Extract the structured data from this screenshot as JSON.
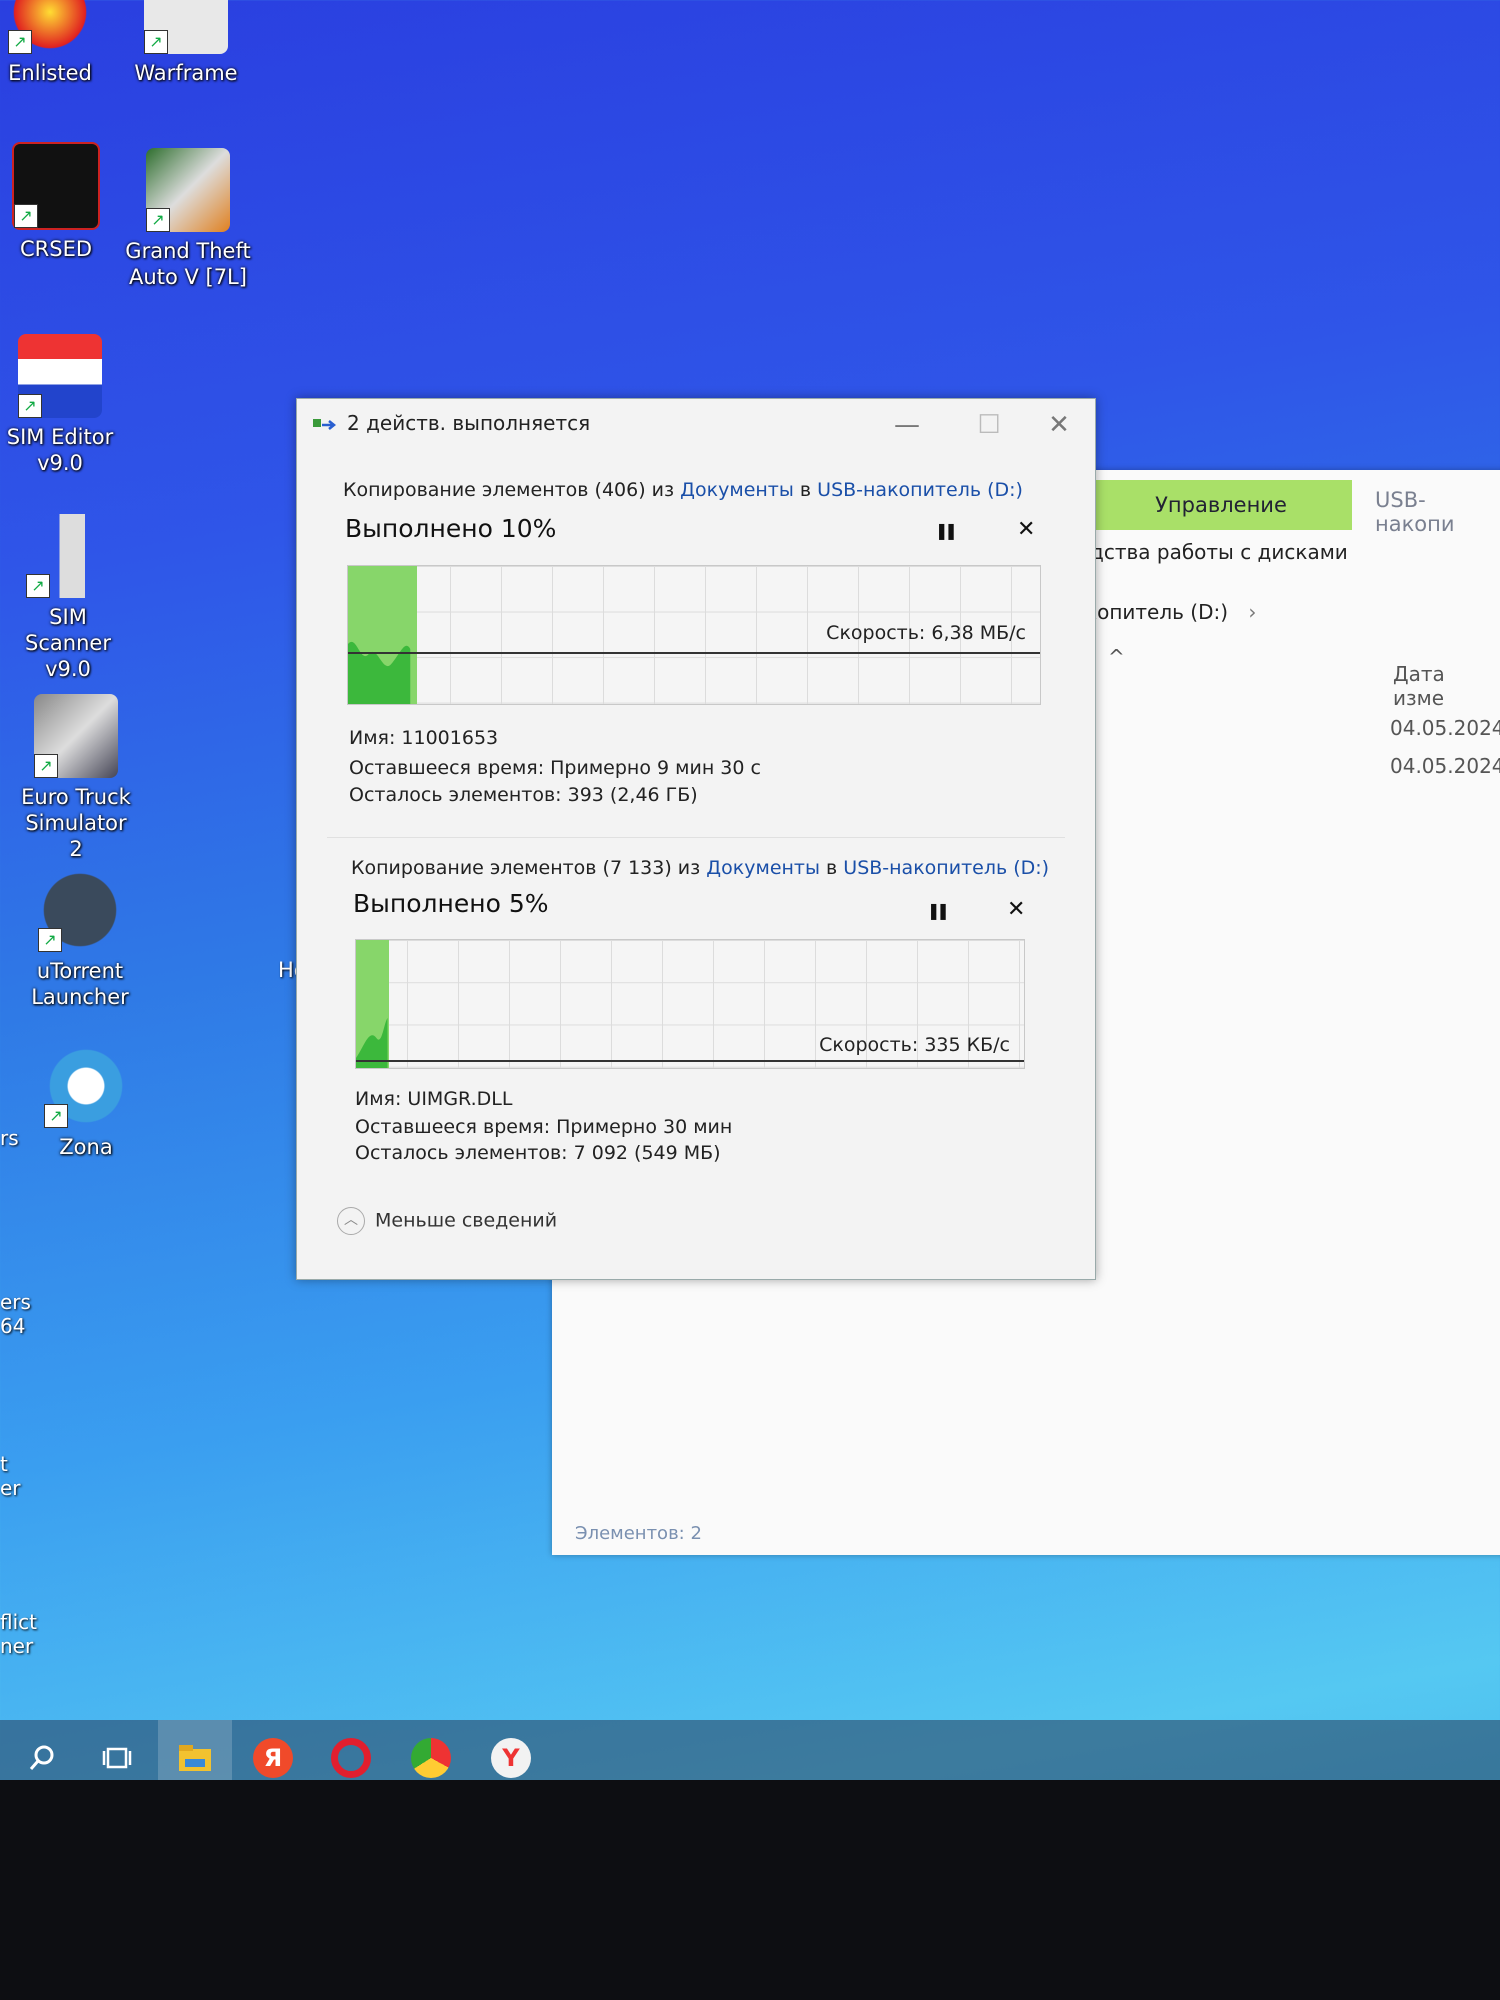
{
  "desktop": {
    "icons": [
      {
        "label": "Enlisted"
      },
      {
        "label": "Warframe"
      },
      {
        "label": "CRSED"
      },
      {
        "label": "Grand Theft Auto V [7L]"
      },
      {
        "label": "SIM Editor v9.0"
      },
      {
        "label": "SIM Scanner v9.0"
      },
      {
        "label": "Euro Truck Simulator 2"
      },
      {
        "label": "uTorrent Launcher"
      },
      {
        "label": "Zona"
      }
    ],
    "partial_labels": [
      "rs",
      "ers",
      "64",
      "t",
      "er",
      "flict",
      "ner",
      "Ho"
    ]
  },
  "explorer": {
    "manage_tab": "Управление",
    "usb_tab": "USB-накопи",
    "tools_text": "дства работы с дисками",
    "address": "копитель (D:)",
    "address_chevron": "›",
    "sort_caret": "^",
    "date_column": "Дата изме",
    "dates": [
      "04.05.2024",
      "04.05.2024"
    ],
    "status": "Элементов: 2"
  },
  "dialog": {
    "title": "2 действ. выполняется",
    "minimize": "—",
    "maximize": "☐",
    "close": "✕",
    "ops": [
      {
        "head_prefix": "Копирование элементов (406) из ",
        "src": "Документы",
        "mid": " в ",
        "dst": "USB-накопитель (D:)",
        "progress_label": "Выполнено 10%",
        "progress": 0.1,
        "pause": "❚❚",
        "cancel": "✕",
        "speed": "Скорость: 6,38 МБ/с",
        "name": "Имя:  11001653",
        "time_left": "Оставшееся время:  Примерно 9 мин 30 с",
        "items_left": "Осталось элементов:  393 (2,46 ГБ)"
      },
      {
        "head_prefix": "Копирование элементов (7 133) из ",
        "src": "Документы",
        "mid": " в ",
        "dst": "USB-накопитель (D:)",
        "progress_label": "Выполнено 5%",
        "progress": 0.05,
        "pause": "❚❚",
        "cancel": "✕",
        "speed": "Скорость: 335 КБ/с",
        "name": "Имя:  UIMGR.DLL",
        "time_left": "Оставшееся время:  Примерно 30 мин",
        "items_left": "Осталось элементов:  7 092 (549 МБ)"
      }
    ],
    "less_details": "Меньше сведений"
  },
  "taskbar": {
    "search_icon": "search-icon",
    "taskview_icon": "task-view-icon",
    "apps": [
      "file-explorer-icon",
      "yandex-icon",
      "opera-icon",
      "chrome-icon",
      "yandex-browser-icon"
    ],
    "yandex_letter": "Я",
    "ybrowser_letter": "Y"
  },
  "colors": {
    "progress_fill": "#87d66a",
    "progress_dark": "#3cb83c",
    "link": "#1a4fa8",
    "manage_tab": "#a9e068"
  }
}
